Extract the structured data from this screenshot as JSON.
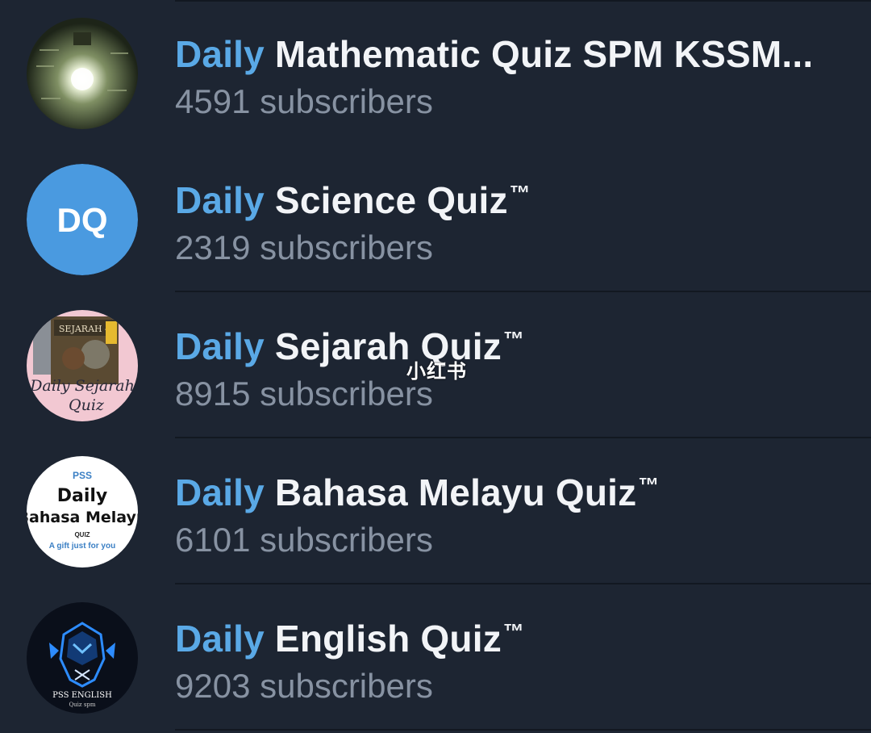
{
  "channels": [
    {
      "highlight": "Daily",
      "name": " Science Quiz",
      "trademark": "™",
      "subscribers": "2319 subscribers",
      "avatar": {
        "type": "initials",
        "text": "DQ",
        "color": "#4a9ae0"
      }
    },
    {
      "highlight": "Daily",
      "name": " Sejarah Quiz",
      "trademark": "™",
      "subscribers": "8915 subscribers",
      "avatar": {
        "type": "image",
        "label": "SEJARAH 4",
        "caption": "Daily Sejarah",
        "caption2": "Quiz",
        "color": "#f2c8d2"
      }
    },
    {
      "highlight": "Daily",
      "name": " Bahasa Melayu Quiz",
      "trademark": "™",
      "subscribers": "6101 subscribers",
      "avatar": {
        "type": "image",
        "top": "PSS",
        "line1": "Daily",
        "line2": "Bahasa Melayu",
        "small": "QUIZ",
        "tagline": "A gift just for you",
        "color": "#ffffff"
      }
    },
    {
      "highlight": "Daily",
      "name": " English Quiz",
      "trademark": "™",
      "subscribers": "9203 subscribers",
      "avatar": {
        "type": "image",
        "line1": "PSS ENGLISH",
        "line2": "Quiz spm",
        "color": "#0a0f1a"
      }
    },
    {
      "highlight": "Daily",
      "name": " Mathematic Quiz SPM KSSM...",
      "trademark": "",
      "subscribers": "4591 subscribers",
      "avatar": {
        "type": "image",
        "color": "#2f3a26"
      }
    }
  ],
  "watermark": "小红书",
  "colors": {
    "background": "#1d2532",
    "highlight": "#5aa9e6",
    "title": "#f2f4f7",
    "subtitle": "#8792a2"
  }
}
